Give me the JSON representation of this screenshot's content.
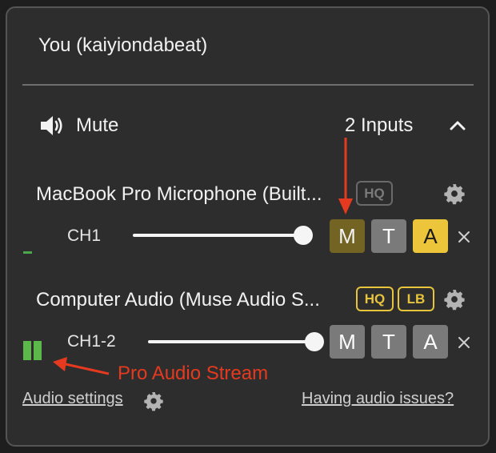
{
  "panel": {
    "title": "You (kaiyiondabeat)"
  },
  "header": {
    "mute_label": "Mute",
    "inputs_label": "2 Inputs"
  },
  "sources": [
    {
      "name": "MacBook Pro Microphone (Built...",
      "badges": [
        "HQ"
      ],
      "channel": "CH1",
      "volume": 1.0,
      "buttons": {
        "m": "M",
        "t": "T",
        "a": "A"
      }
    },
    {
      "name": "Computer Audio (Muse Audio S...",
      "badges": [
        "HQ",
        "LB"
      ],
      "channel": "CH1-2",
      "volume": 1.0,
      "buttons": {
        "m": "M",
        "t": "T",
        "a": "A"
      }
    }
  ],
  "annotation": {
    "label": "Pro Audio Stream",
    "color": "#e53a1f"
  },
  "footer": {
    "audio_settings": "Audio settings",
    "issues": "Having audio issues?"
  },
  "colors": {
    "accent": "#ecc53a",
    "muted_active": "#736423",
    "meter": "#5cb84a"
  }
}
